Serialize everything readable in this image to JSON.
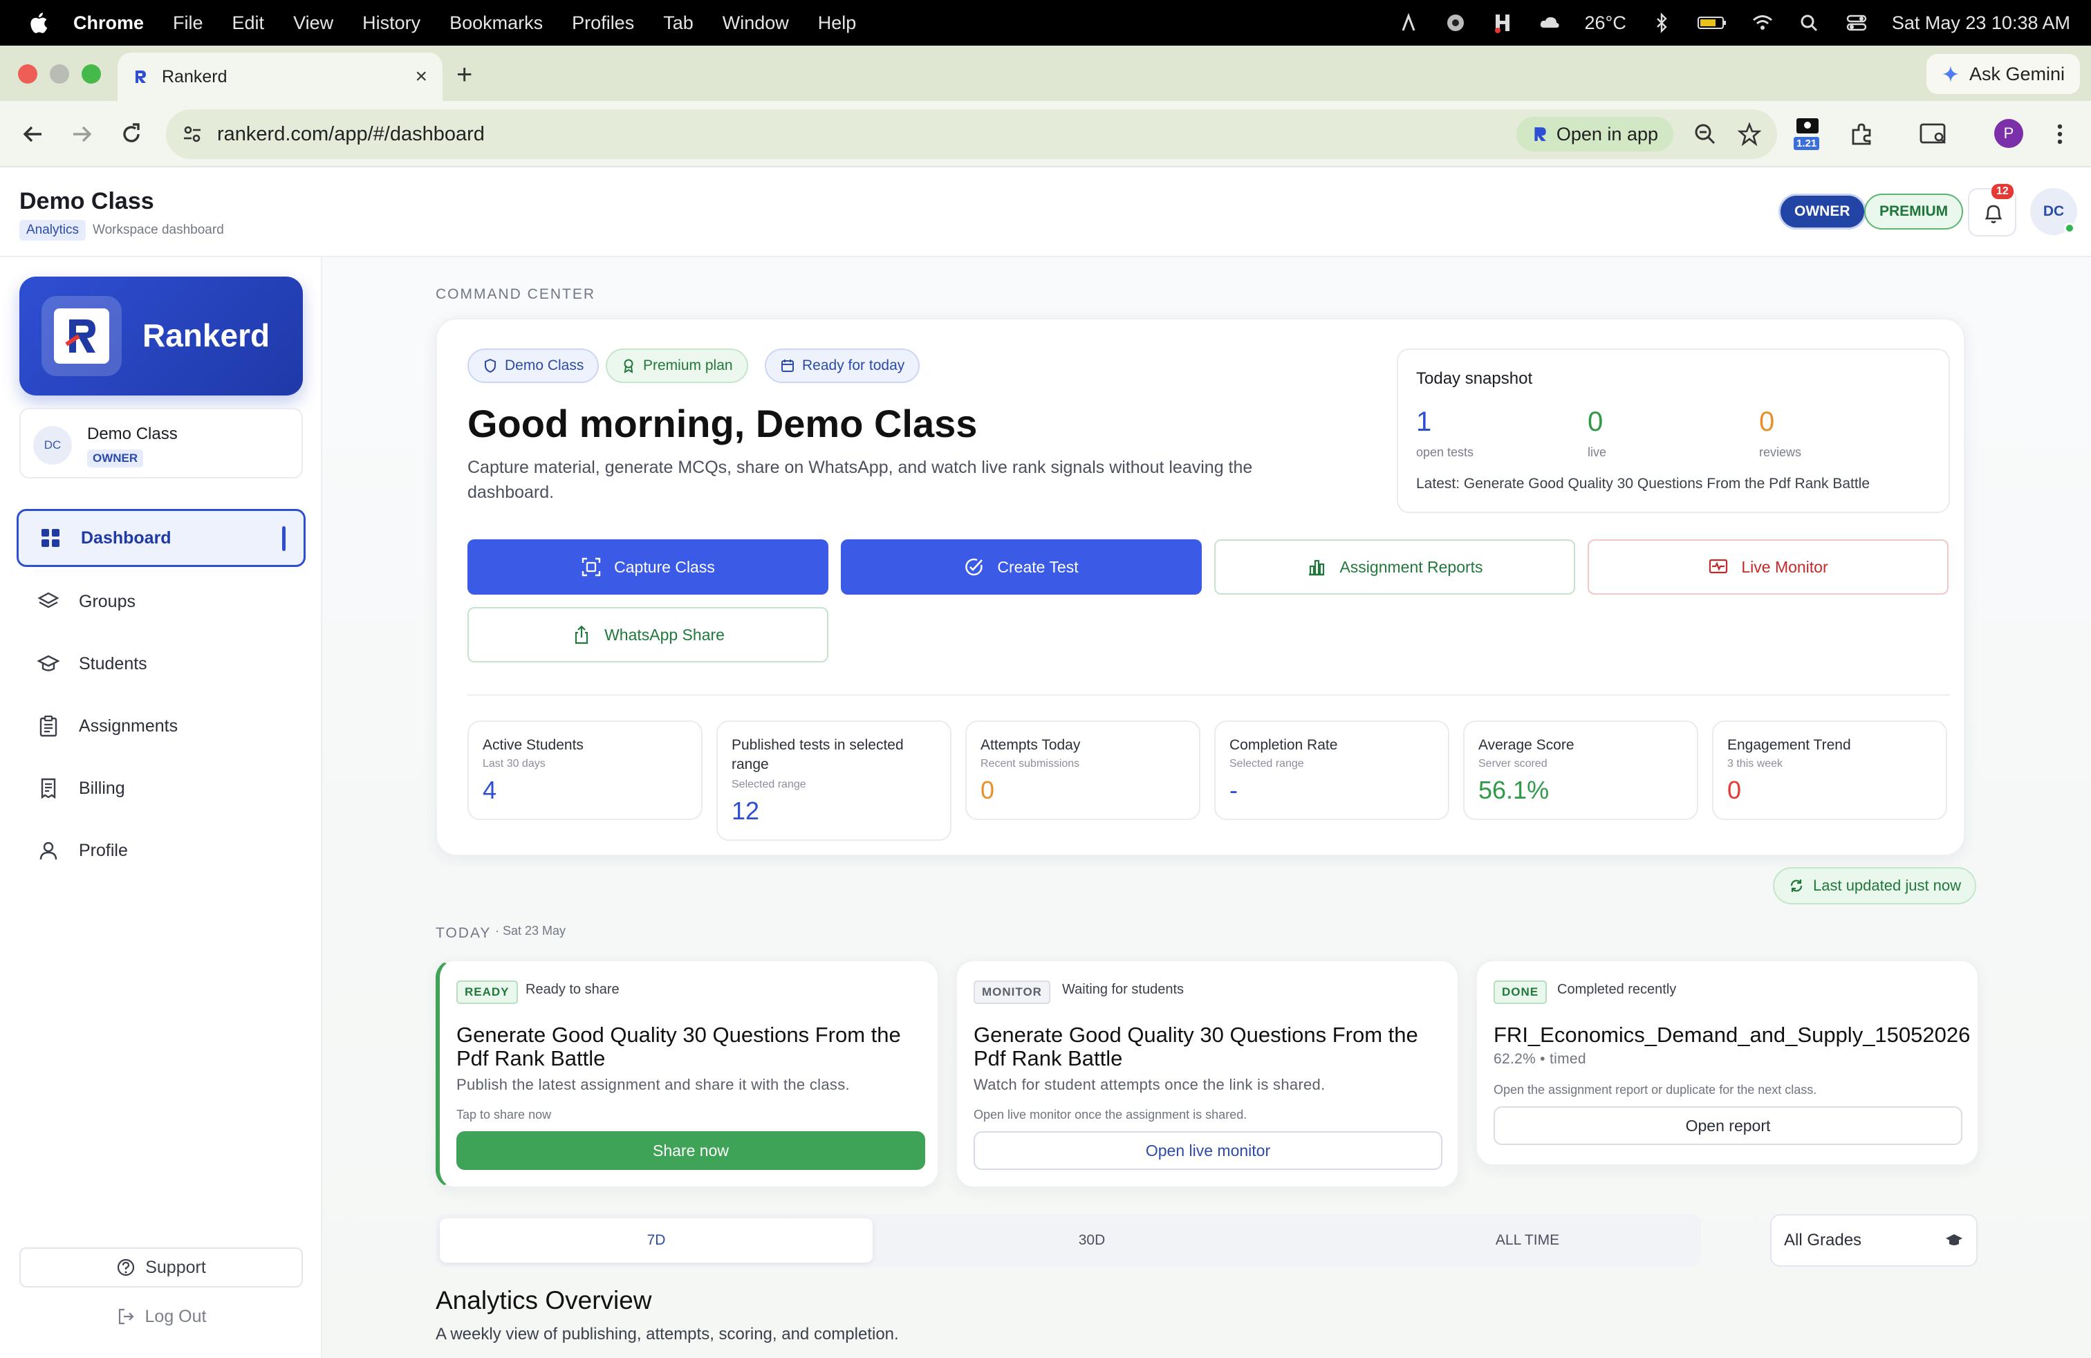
{
  "menubar": {
    "apple_icon": "apple-icon",
    "app": "Chrome",
    "items": [
      "File",
      "Edit",
      "View",
      "History",
      "Bookmarks",
      "Profiles",
      "Tab",
      "Window",
      "Help"
    ],
    "weather": "26°C",
    "datetime": "Sat May 23  10:38 AM"
  },
  "browser": {
    "tab_title": "Rankerd",
    "ask_gemini": "Ask Gemini",
    "url": "rankerd.com/app/#/dashboard",
    "open_in_app": "Open in app",
    "extension_badge": "1.21",
    "profile_initial": "P"
  },
  "app_header": {
    "title": "Demo Class",
    "chip": "Analytics",
    "subtitle": "Workspace dashboard",
    "owner_badge": "OWNER",
    "premium_badge": "PREMIUM",
    "notification_count": "12",
    "avatar": "DC"
  },
  "sidebar": {
    "brand": "Rankerd",
    "workspace": {
      "avatar": "DC",
      "name": "Demo Class",
      "role": "OWNER"
    },
    "nav": [
      {
        "label": "Dashboard",
        "icon": "grid-icon",
        "active": true
      },
      {
        "label": "Groups",
        "icon": "layers-icon"
      },
      {
        "label": "Students",
        "icon": "graduation-cap-icon"
      },
      {
        "label": "Assignments",
        "icon": "clipboard-icon"
      },
      {
        "label": "Billing",
        "icon": "receipt-icon"
      },
      {
        "label": "Profile",
        "icon": "user-icon"
      }
    ],
    "support": "Support",
    "logout": "Log Out"
  },
  "command_center": {
    "label": "COMMAND CENTER",
    "chips": [
      "Demo Class",
      "Premium plan",
      "Ready for today"
    ],
    "greeting": "Good morning, Demo Class",
    "subtitle": "Capture material, generate MCQs, share on WhatsApp, and watch live rank signals without leaving the dashboard.",
    "snapshot": {
      "title": "Today snapshot",
      "items": [
        {
          "value": "1",
          "label": "open tests",
          "color": "#2f4fd3"
        },
        {
          "value": "0",
          "label": "live",
          "color": "#2e9a48"
        },
        {
          "value": "0",
          "label": "reviews",
          "color": "#e8912c"
        }
      ],
      "latest": "Latest: Generate Good Quality 30 Questions From the Pdf Rank Battle"
    },
    "actions": {
      "capture": "Capture Class",
      "create": "Create Test",
      "reports": "Assignment Reports",
      "monitor": "Live Monitor",
      "whatsapp": "WhatsApp Share"
    },
    "stats": [
      {
        "title": "Active Students",
        "sub": "Last 30 days",
        "value": "4",
        "color": "#2f4fd3"
      },
      {
        "title": "Published tests in selected range",
        "sub": "Selected range",
        "value": "12",
        "color": "#2f4fd3"
      },
      {
        "title": "Attempts Today",
        "sub": "Recent submissions",
        "value": "0",
        "color": "#e8912c"
      },
      {
        "title": "Completion Rate",
        "sub": "Selected range",
        "value": "-",
        "color": "#2f4fd3"
      },
      {
        "title": "Average Score",
        "sub": "Server scored",
        "value": "56.1%",
        "color": "#2e9a48"
      },
      {
        "title": "Engagement Trend",
        "sub": "3 this week",
        "value": "0",
        "color": "#e53935"
      }
    ]
  },
  "last_updated": "Last updated just now",
  "today": {
    "label": "TODAY",
    "date": "· Sat 23 May",
    "cards": [
      {
        "tag": "READY",
        "tag_text": "Ready to share",
        "title": "Generate Good Quality 30 Questions From the Pdf Rank Battle",
        "desc": "Publish the latest assignment and share it with the class.",
        "hint": "Tap to share now",
        "cta": "Share now"
      },
      {
        "tag": "MONITOR",
        "tag_text": "Waiting for students",
        "title": "Generate Good Quality 30 Questions From the Pdf Rank Battle",
        "desc": "Watch for student attempts once the link is shared.",
        "hint": "Open live monitor once the assignment is shared.",
        "cta": "Open live monitor"
      },
      {
        "tag": "DONE",
        "tag_text": "Completed recently",
        "title": "FRI_Economics_Demand_and_Supply_15052026",
        "desc": "62.2% • timed",
        "hint": "Open the assignment report or duplicate for the next class.",
        "cta": "Open report"
      }
    ]
  },
  "range": {
    "tabs": [
      "7D",
      "30D",
      "ALL TIME"
    ],
    "active": "7D",
    "grade": "All Grades"
  },
  "analytics": {
    "title": "Analytics Overview",
    "subtitle": "A weekly view of publishing, attempts, scoring, and completion."
  }
}
